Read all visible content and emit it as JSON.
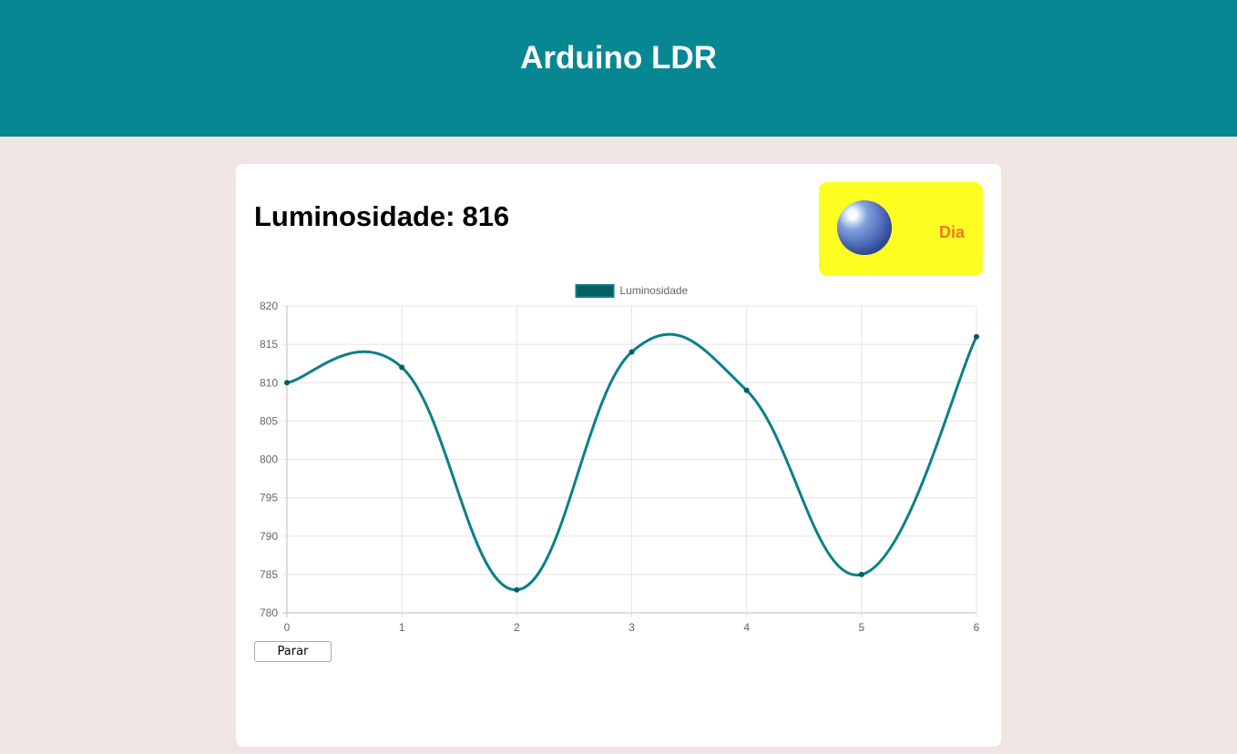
{
  "header": {
    "title": "Arduino LDR"
  },
  "reading": {
    "label": "Luminosidade:",
    "value": "816"
  },
  "status": {
    "label": "Dia",
    "icon": "sun-icon",
    "background": "#fdfd22",
    "text_color": "#f07a22"
  },
  "controls": {
    "stop_label": "Parar"
  },
  "colors": {
    "header": "#078791",
    "page_background": "#efe5e3",
    "line": "#0a8088",
    "point": "#055e60"
  },
  "chart_data": {
    "type": "line",
    "title": "",
    "xlabel": "",
    "ylabel": "",
    "x": [
      0,
      1,
      2,
      3,
      4,
      5,
      6
    ],
    "series": [
      {
        "name": "Luminosidade",
        "values": [
          810,
          812,
          783,
          814,
          809,
          785,
          816
        ]
      }
    ],
    "ylim": [
      780,
      820
    ],
    "yticks": [
      "780",
      "785",
      "790",
      "795",
      "800",
      "805",
      "810",
      "815",
      "820"
    ],
    "xticks": [
      "0",
      "1",
      "2",
      "3",
      "4",
      "5",
      "6"
    ],
    "grid": true,
    "legend": "top-center",
    "smooth": true
  }
}
